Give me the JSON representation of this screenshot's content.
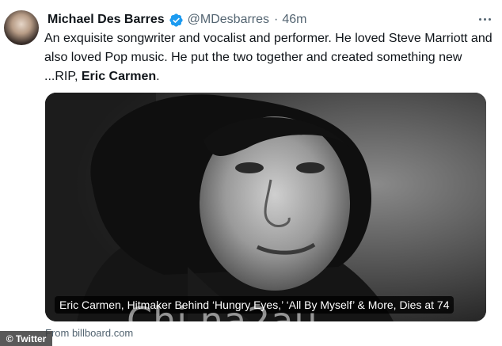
{
  "tweet": {
    "author_name": "Michael Des Barres",
    "handle": "@MDesbarres",
    "separator": "·",
    "time": "46m",
    "text_before": "An exquisite songwriter and vocalist and performer. He loved Steve Marriott and also loved Pop music. He put the two together and created something new ...RIP, ",
    "text_mention": "Eric Carmen",
    "text_after": "."
  },
  "card": {
    "caption": "Eric Carmen, Hitmaker Behind ‘Hungry Eyes,’ ‘All By Myself’ & More, Dies at 74",
    "source": "From billboard.com"
  },
  "overlays": {
    "watermark": "Chi na2au",
    "badge": "© Twitter"
  },
  "icons": {
    "verified": "verified-badge-icon",
    "more": "more-options-icon"
  },
  "colors": {
    "verified_blue": "#1d9bf0",
    "secondary_text": "#536471"
  }
}
